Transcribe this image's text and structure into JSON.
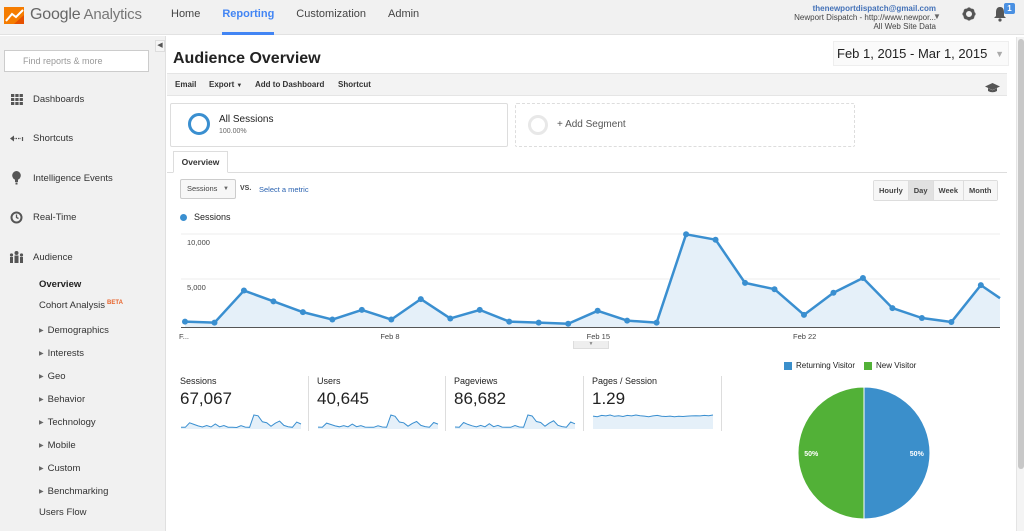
{
  "app": {
    "logo_text_brand": "Google",
    "logo_text_product": "Analytics"
  },
  "nav": {
    "items": [
      {
        "label": "Home",
        "active": false
      },
      {
        "label": "Reporting",
        "active": true
      },
      {
        "label": "Customization",
        "active": false
      },
      {
        "label": "Admin",
        "active": false
      }
    ]
  },
  "account": {
    "email": "thenewportdispatch@gmail.com",
    "property": "Newport Dispatch - http://www.newpor...",
    "view": "All Web Site Data",
    "notification_count": "1"
  },
  "sidebar": {
    "search_placeholder": "Find reports & more",
    "collapse_icon": "collapse-left-icon",
    "items": [
      {
        "label": "Dashboards",
        "icon": "dashboards-icon"
      },
      {
        "label": "Shortcuts",
        "icon": "shortcuts-icon"
      },
      {
        "label": "Intelligence Events",
        "icon": "lightbulb-icon"
      },
      {
        "label": "Real-Time",
        "icon": "clock-icon"
      },
      {
        "label": "Audience",
        "icon": "audience-icon"
      }
    ],
    "audience_sub": [
      {
        "label": "Overview",
        "active": true,
        "expandable": false
      },
      {
        "label": "Cohort Analysis",
        "badge": "BETA",
        "expandable": false
      },
      {
        "label": "Demographics",
        "expandable": true
      },
      {
        "label": "Interests",
        "expandable": true
      },
      {
        "label": "Geo",
        "expandable": true
      },
      {
        "label": "Behavior",
        "expandable": true
      },
      {
        "label": "Technology",
        "expandable": true
      },
      {
        "label": "Mobile",
        "expandable": true
      },
      {
        "label": "Custom",
        "expandable": true
      },
      {
        "label": "Benchmarking",
        "expandable": true
      },
      {
        "label": "Users Flow",
        "expandable": false
      }
    ]
  },
  "report": {
    "title": "Audience Overview",
    "date_range": "Feb 1, 2015 - Mar 1, 2015",
    "toolbar": {
      "email": "Email",
      "export": "Export",
      "add_to_dashboard": "Add to Dashboard",
      "shortcut": "Shortcut"
    },
    "segment": {
      "name": "All Sessions",
      "percent": "100.00%",
      "add_label": "+ Add Segment"
    },
    "tab": "Overview",
    "metric_selector": {
      "selected": "Sessions",
      "vs_label": "VS.",
      "select_metric_link": "Select a metric"
    },
    "granularity": [
      {
        "label": "Hourly",
        "active": false
      },
      {
        "label": "Day",
        "active": true
      },
      {
        "label": "Week",
        "active": false
      },
      {
        "label": "Month",
        "active": false
      }
    ]
  },
  "colors": {
    "accent_blue": "#4285f4",
    "series_blue": "#3a8fd0",
    "series_fill": "#e5f0f9",
    "new_visitor_green": "#52b137",
    "returning_blue": "#3b8fcb"
  },
  "chart_data": [
    {
      "type": "area",
      "title": "",
      "legend": [
        "Sessions"
      ],
      "legend_placement": "top-left",
      "xlabel": "",
      "ylabel": "",
      "ylim": [
        0,
        10000
      ],
      "y_ticks": [
        {
          "value": 10000,
          "label": "10,000"
        },
        {
          "value": 5000,
          "label": "5,000"
        }
      ],
      "x_tick_labels": [
        {
          "index": 0,
          "label": "F..."
        },
        {
          "index": 7,
          "label": "Feb 8"
        },
        {
          "index": 14,
          "label": "Feb 15"
        },
        {
          "index": 21,
          "label": "Feb 22"
        }
      ],
      "grid": true,
      "series": [
        {
          "name": "Sessions",
          "x": [
            "Feb 1",
            "Feb 2",
            "Feb 3",
            "Feb 4",
            "Feb 5",
            "Feb 6",
            "Feb 7",
            "Feb 8",
            "Feb 9",
            "Feb 10",
            "Feb 11",
            "Feb 12",
            "Feb 13",
            "Feb 14",
            "Feb 15",
            "Feb 16",
            "Feb 17",
            "Feb 18",
            "Feb 19",
            "Feb 20",
            "Feb 21",
            "Feb 22",
            "Feb 23",
            "Feb 24",
            "Feb 25",
            "Feb 26",
            "Feb 27",
            "Feb 28",
            "Mar 1"
          ],
          "values": [
            600,
            480,
            4050,
            2850,
            1650,
            830,
            1900,
            830,
            3100,
            950,
            1900,
            600,
            480,
            360,
            1800,
            710,
            480,
            10300,
            9700,
            4900,
            4200,
            1350,
            3800,
            5450,
            2100,
            1000,
            550,
            4650,
            3200
          ]
        }
      ]
    },
    {
      "type": "pie",
      "legend": [
        "Returning Visitor",
        "New Visitor"
      ],
      "legend_placement": "top",
      "slices": [
        {
          "label": "Returning Visitor",
          "value": 50,
          "display": "50%"
        },
        {
          "label": "New Visitor",
          "value": 50,
          "display": "50%"
        }
      ]
    }
  ],
  "scorecards": [
    {
      "label": "Sessions",
      "value": "67,067",
      "spark": [
        6,
        5,
        40,
        28,
        16,
        8,
        19,
        8,
        31,
        9,
        19,
        6,
        5,
        4,
        18,
        7,
        5,
        100,
        94,
        48,
        41,
        13,
        37,
        53,
        20,
        10,
        5,
        45,
        31
      ]
    },
    {
      "label": "Users",
      "value": "40,645",
      "spark": [
        7,
        6,
        38,
        27,
        16,
        9,
        18,
        9,
        30,
        10,
        18,
        7,
        6,
        5,
        17,
        8,
        6,
        100,
        90,
        46,
        40,
        14,
        35,
        50,
        20,
        11,
        6,
        42,
        30
      ]
    },
    {
      "label": "Pageviews",
      "value": "86,682",
      "spark": [
        8,
        6,
        42,
        28,
        17,
        9,
        20,
        9,
        33,
        10,
        20,
        7,
        6,
        5,
        19,
        8,
        6,
        100,
        92,
        50,
        42,
        14,
        38,
        55,
        21,
        11,
        6,
        46,
        32
      ]
    },
    {
      "label": "Pages / Session",
      "value": "1.29",
      "spark": [
        55,
        52,
        58,
        56,
        60,
        54,
        57,
        53,
        58,
        56,
        60,
        57,
        55,
        52,
        56,
        58,
        54,
        53,
        55,
        52,
        54,
        53,
        55,
        56,
        57,
        56,
        58,
        57,
        60
      ]
    }
  ]
}
